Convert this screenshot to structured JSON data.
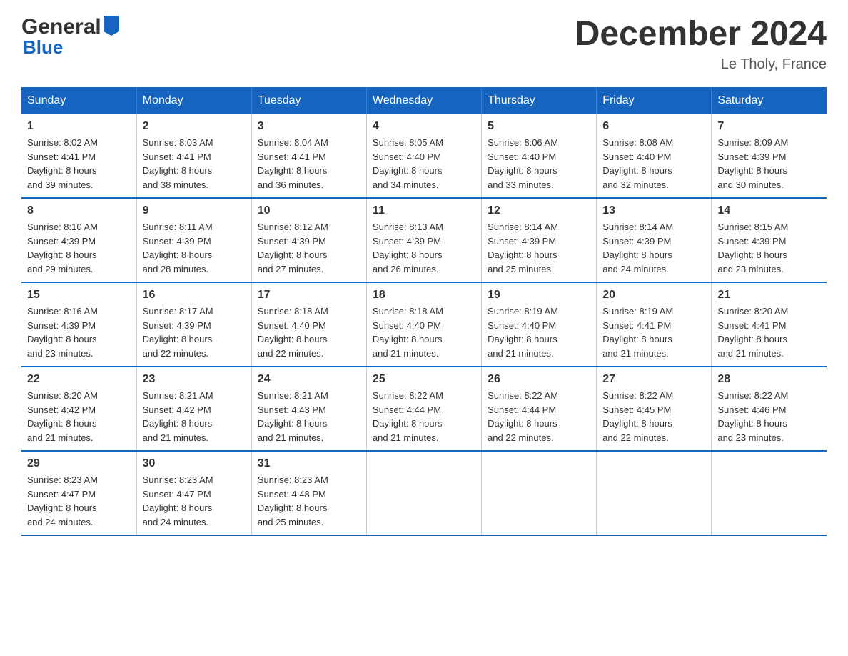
{
  "header": {
    "logo_general": "General",
    "logo_blue": "Blue",
    "title": "December 2024",
    "subtitle": "Le Tholy, France"
  },
  "days_of_week": [
    "Sunday",
    "Monday",
    "Tuesday",
    "Wednesday",
    "Thursday",
    "Friday",
    "Saturday"
  ],
  "weeks": [
    [
      {
        "day": "1",
        "sunrise": "8:02 AM",
        "sunset": "4:41 PM",
        "daylight": "8 hours and 39 minutes."
      },
      {
        "day": "2",
        "sunrise": "8:03 AM",
        "sunset": "4:41 PM",
        "daylight": "8 hours and 38 minutes."
      },
      {
        "day": "3",
        "sunrise": "8:04 AM",
        "sunset": "4:41 PM",
        "daylight": "8 hours and 36 minutes."
      },
      {
        "day": "4",
        "sunrise": "8:05 AM",
        "sunset": "4:40 PM",
        "daylight": "8 hours and 34 minutes."
      },
      {
        "day": "5",
        "sunrise": "8:06 AM",
        "sunset": "4:40 PM",
        "daylight": "8 hours and 33 minutes."
      },
      {
        "day": "6",
        "sunrise": "8:08 AM",
        "sunset": "4:40 PM",
        "daylight": "8 hours and 32 minutes."
      },
      {
        "day": "7",
        "sunrise": "8:09 AM",
        "sunset": "4:39 PM",
        "daylight": "8 hours and 30 minutes."
      }
    ],
    [
      {
        "day": "8",
        "sunrise": "8:10 AM",
        "sunset": "4:39 PM",
        "daylight": "8 hours and 29 minutes."
      },
      {
        "day": "9",
        "sunrise": "8:11 AM",
        "sunset": "4:39 PM",
        "daylight": "8 hours and 28 minutes."
      },
      {
        "day": "10",
        "sunrise": "8:12 AM",
        "sunset": "4:39 PM",
        "daylight": "8 hours and 27 minutes."
      },
      {
        "day": "11",
        "sunrise": "8:13 AM",
        "sunset": "4:39 PM",
        "daylight": "8 hours and 26 minutes."
      },
      {
        "day": "12",
        "sunrise": "8:14 AM",
        "sunset": "4:39 PM",
        "daylight": "8 hours and 25 minutes."
      },
      {
        "day": "13",
        "sunrise": "8:14 AM",
        "sunset": "4:39 PM",
        "daylight": "8 hours and 24 minutes."
      },
      {
        "day": "14",
        "sunrise": "8:15 AM",
        "sunset": "4:39 PM",
        "daylight": "8 hours and 23 minutes."
      }
    ],
    [
      {
        "day": "15",
        "sunrise": "8:16 AM",
        "sunset": "4:39 PM",
        "daylight": "8 hours and 23 minutes."
      },
      {
        "day": "16",
        "sunrise": "8:17 AM",
        "sunset": "4:39 PM",
        "daylight": "8 hours and 22 minutes."
      },
      {
        "day": "17",
        "sunrise": "8:18 AM",
        "sunset": "4:40 PM",
        "daylight": "8 hours and 22 minutes."
      },
      {
        "day": "18",
        "sunrise": "8:18 AM",
        "sunset": "4:40 PM",
        "daylight": "8 hours and 21 minutes."
      },
      {
        "day": "19",
        "sunrise": "8:19 AM",
        "sunset": "4:40 PM",
        "daylight": "8 hours and 21 minutes."
      },
      {
        "day": "20",
        "sunrise": "8:19 AM",
        "sunset": "4:41 PM",
        "daylight": "8 hours and 21 minutes."
      },
      {
        "day": "21",
        "sunrise": "8:20 AM",
        "sunset": "4:41 PM",
        "daylight": "8 hours and 21 minutes."
      }
    ],
    [
      {
        "day": "22",
        "sunrise": "8:20 AM",
        "sunset": "4:42 PM",
        "daylight": "8 hours and 21 minutes."
      },
      {
        "day": "23",
        "sunrise": "8:21 AM",
        "sunset": "4:42 PM",
        "daylight": "8 hours and 21 minutes."
      },
      {
        "day": "24",
        "sunrise": "8:21 AM",
        "sunset": "4:43 PM",
        "daylight": "8 hours and 21 minutes."
      },
      {
        "day": "25",
        "sunrise": "8:22 AM",
        "sunset": "4:44 PM",
        "daylight": "8 hours and 21 minutes."
      },
      {
        "day": "26",
        "sunrise": "8:22 AM",
        "sunset": "4:44 PM",
        "daylight": "8 hours and 22 minutes."
      },
      {
        "day": "27",
        "sunrise": "8:22 AM",
        "sunset": "4:45 PM",
        "daylight": "8 hours and 22 minutes."
      },
      {
        "day": "28",
        "sunrise": "8:22 AM",
        "sunset": "4:46 PM",
        "daylight": "8 hours and 23 minutes."
      }
    ],
    [
      {
        "day": "29",
        "sunrise": "8:23 AM",
        "sunset": "4:47 PM",
        "daylight": "8 hours and 24 minutes."
      },
      {
        "day": "30",
        "sunrise": "8:23 AM",
        "sunset": "4:47 PM",
        "daylight": "8 hours and 24 minutes."
      },
      {
        "day": "31",
        "sunrise": "8:23 AM",
        "sunset": "4:48 PM",
        "daylight": "8 hours and 25 minutes."
      },
      null,
      null,
      null,
      null
    ]
  ],
  "labels": {
    "sunrise": "Sunrise:",
    "sunset": "Sunset:",
    "daylight": "Daylight:"
  }
}
